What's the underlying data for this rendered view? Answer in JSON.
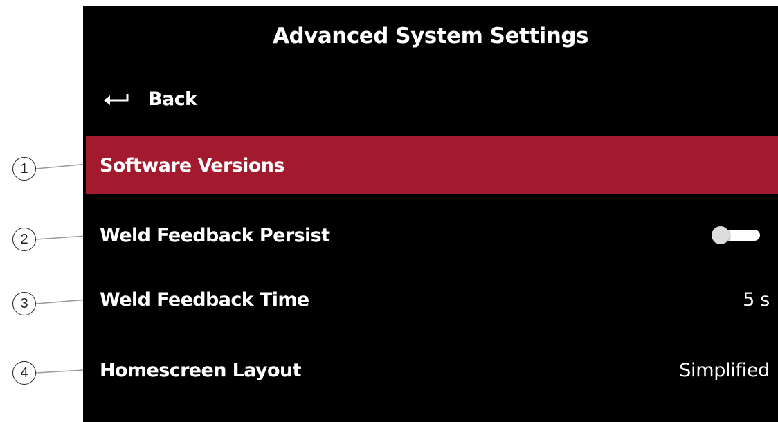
{
  "screen": {
    "title": "Advanced System Settings",
    "back": {
      "label": "Back",
      "icon": "return-arrow-icon"
    },
    "items": [
      {
        "label": "Software Versions",
        "selected": true
      },
      {
        "label": "Weld Feedback Persist",
        "toggle": {
          "on": false
        }
      },
      {
        "label": "Weld Feedback Time",
        "value": "5 s"
      },
      {
        "label": "Homescreen Layout",
        "value": "Simplified"
      }
    ],
    "selected_color": "#a31a2f"
  },
  "callouts": [
    "1",
    "2",
    "3",
    "4"
  ]
}
